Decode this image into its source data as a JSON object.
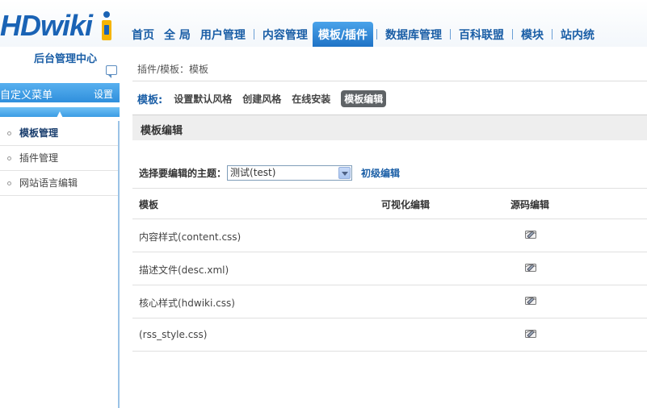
{
  "header": {
    "logo_text": "HDwiki",
    "subtitle": "后台管理中心",
    "nav": [
      {
        "label": "首页"
      },
      {
        "label": "全 局"
      },
      {
        "label": "用户管理"
      },
      {
        "label": "内容管理"
      },
      {
        "label": "模板/插件",
        "active": true
      },
      {
        "label": "数据库管理"
      },
      {
        "label": "百科联盟"
      },
      {
        "label": "模块"
      },
      {
        "label": "站内统"
      }
    ]
  },
  "sidebar": {
    "custom_menu_label": "自定义菜单",
    "settings_label": "设置",
    "items": [
      {
        "label": "模板管理",
        "active": true
      },
      {
        "label": "插件管理"
      },
      {
        "label": "网站语言编辑"
      }
    ]
  },
  "main": {
    "breadcrumb": "插件/模板：模板",
    "subnav": {
      "label": "模板:",
      "tabs": [
        {
          "label": "设置默认风格"
        },
        {
          "label": "创建风格"
        },
        {
          "label": "在线安装"
        },
        {
          "label": "模板编辑",
          "active": true
        }
      ]
    },
    "section_title": "模板编辑",
    "theme_label": "选择要编辑的主题：",
    "theme_selected": "测试(test)",
    "advanced_link": "初级编辑",
    "table": {
      "headers": [
        "模板",
        "可视化编辑",
        "源码编辑"
      ],
      "rows": [
        {
          "name": "内容样式(content.css)"
        },
        {
          "name": "描述文件(desc.xml)"
        },
        {
          "name": "核心样式(hdwiki.css)"
        },
        {
          "name": "(rss_style.css)"
        }
      ]
    }
  },
  "colors": {
    "brand_blue": "#1a5ea6",
    "active_tab": "#2f8fdc",
    "logo_yellow": "#f5b400"
  },
  "icons": {
    "row_edit": "source-edit-icon",
    "chat": "chat-bubble-icon",
    "collapse": "chevron-up-icon"
  }
}
